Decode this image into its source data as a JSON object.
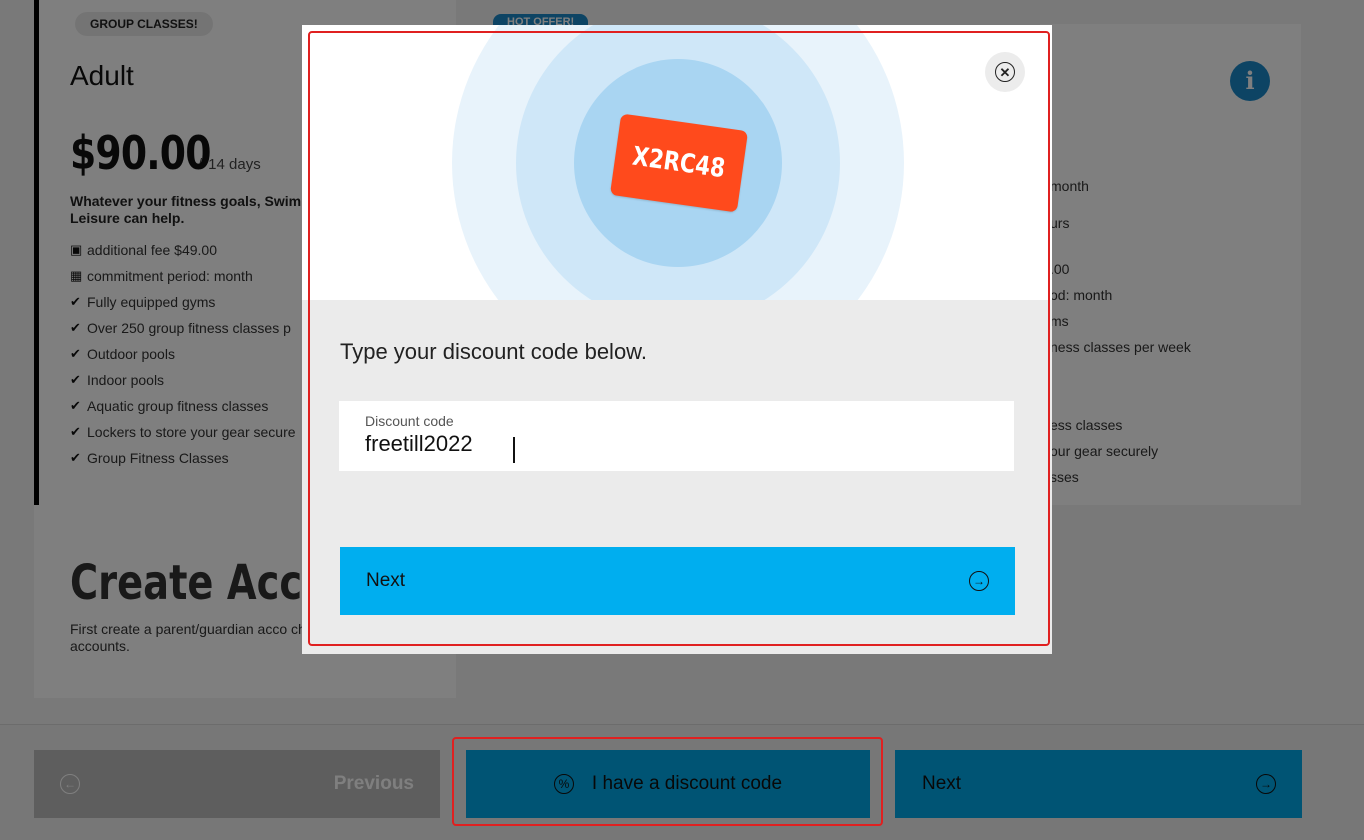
{
  "plan": {
    "badge": "GROUP CLASSES!",
    "hot_badge": "HOT OFFER!",
    "title": "Adult",
    "price": "$90.00",
    "separator": "/",
    "period": "14 days",
    "description": "Whatever your fitness goals, Swim Leisure can help.",
    "features": [
      {
        "icon": "receipt-icon",
        "glyph": "▣",
        "text": "additional fee $49.00"
      },
      {
        "icon": "calendar-icon",
        "glyph": "▦",
        "text": "commitment period: month"
      },
      {
        "icon": "check-icon",
        "glyph": "✔",
        "text": "Fully equipped gyms"
      },
      {
        "icon": "check-icon",
        "glyph": "✔",
        "text": "Over 250 group fitness classes p"
      },
      {
        "icon": "check-icon",
        "glyph": "✔",
        "text": "Outdoor pools"
      },
      {
        "icon": "check-icon",
        "glyph": "✔",
        "text": "Indoor pools"
      },
      {
        "icon": "check-icon",
        "glyph": "✔",
        "text": "Aquatic group fitness classes"
      },
      {
        "icon": "check-icon",
        "glyph": "✔",
        "text": "Lockers to store your gear secure"
      },
      {
        "icon": "check-icon",
        "glyph": "✔",
        "text": "Group Fitness Classes"
      }
    ]
  },
  "right_plan": {
    "info_glyph": "i",
    "lines": [
      "month",
      "urs",
      ".00",
      "od: month",
      "ms",
      "ness classes per week",
      "",
      "",
      "ess classes",
      "our gear securely",
      "sses"
    ]
  },
  "create": {
    "title": "Create Accou",
    "description": "First create a parent/guardian acco child accounts."
  },
  "footer": {
    "previous_label": "Previous",
    "discount_label": "I have a discount code",
    "next_label": "Next"
  },
  "modal": {
    "code_card_text": "X2RC48",
    "prompt": "Type your discount code below.",
    "field_label": "Discount code",
    "field_value": "freetill2022",
    "next_label": "Next"
  },
  "colors": {
    "accent": "#00aeef",
    "highlight": "#e02020",
    "code_card": "#ff4a1c",
    "info": "#1a88c9"
  }
}
